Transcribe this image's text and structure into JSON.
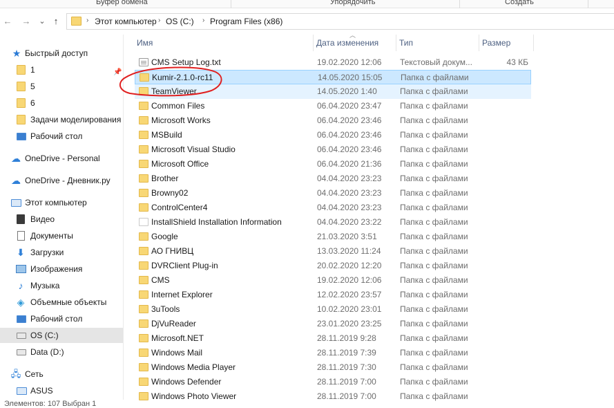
{
  "ribbon": {
    "groups": [
      "Буфер обмена",
      "Упорядочить",
      "Создать"
    ]
  },
  "nav_buttons": {
    "back": "←",
    "forward": "→",
    "dropdown": "⌄",
    "up": "↑"
  },
  "address": {
    "crumbs": [
      "Этот компьютер",
      "OS (C:)",
      "Program Files (x86)"
    ],
    "separator": "›"
  },
  "sidebar": {
    "items": [
      {
        "label": "Быстрый доступ",
        "icon": "star-icon"
      },
      {
        "label": "1",
        "icon": "folder-icon",
        "pinned": true
      },
      {
        "label": "5",
        "icon": "folder-icon"
      },
      {
        "label": "6",
        "icon": "folder-icon"
      },
      {
        "label": "Задачи моделирования",
        "icon": "folder-icon"
      },
      {
        "label": "Рабочий стол",
        "icon": "desktop-icon"
      },
      {
        "label": "OneDrive - Personal",
        "icon": "cloud-icon"
      },
      {
        "label": "OneDrive - Дневник.ру",
        "icon": "cloud-icon"
      },
      {
        "label": "Этот компьютер",
        "icon": "computer-icon"
      },
      {
        "label": "Видео",
        "icon": "video-icon"
      },
      {
        "label": "Документы",
        "icon": "documents-icon"
      },
      {
        "label": "Загрузки",
        "icon": "downloads-icon"
      },
      {
        "label": "Изображения",
        "icon": "pictures-icon"
      },
      {
        "label": "Музыка",
        "icon": "music-icon"
      },
      {
        "label": "Объемные объекты",
        "icon": "3d-objects-icon"
      },
      {
        "label": "Рабочий стол",
        "icon": "desktop-icon"
      },
      {
        "label": "OS (C:)",
        "icon": "drive-icon",
        "selected": true
      },
      {
        "label": "Data (D:)",
        "icon": "drive-icon"
      },
      {
        "label": "Сеть",
        "icon": "network-icon"
      },
      {
        "label": "ASUS",
        "icon": "computer-icon"
      }
    ]
  },
  "columns": {
    "name": "Имя",
    "date": "Дата изменения",
    "type": "Тип",
    "size": "Размер"
  },
  "files": [
    {
      "name": "CMS Setup Log.txt",
      "date": "19.02.2020 12:06",
      "type": "Текстовый докум...",
      "size": "43 КБ",
      "icon": "text-file-icon"
    },
    {
      "name": "Kumir-2.1.0-rc11",
      "date": "14.05.2020 15:05",
      "type": "Папка с файлами",
      "size": "",
      "icon": "folder-icon",
      "state": "selected"
    },
    {
      "name": "TeamViewer",
      "date": "14.05.2020 1:40",
      "type": "Папка с файлами",
      "size": "",
      "icon": "folder-icon",
      "state": "hover"
    },
    {
      "name": "Common Files",
      "date": "06.04.2020 23:47",
      "type": "Папка с файлами",
      "size": "",
      "icon": "folder-icon"
    },
    {
      "name": "Microsoft Works",
      "date": "06.04.2020 23:46",
      "type": "Папка с файлами",
      "size": "",
      "icon": "folder-icon"
    },
    {
      "name": "MSBuild",
      "date": "06.04.2020 23:46",
      "type": "Папка с файлами",
      "size": "",
      "icon": "folder-icon"
    },
    {
      "name": "Microsoft Visual Studio",
      "date": "06.04.2020 23:46",
      "type": "Папка с файлами",
      "size": "",
      "icon": "folder-icon"
    },
    {
      "name": "Microsoft Office",
      "date": "06.04.2020 21:36",
      "type": "Папка с файлами",
      "size": "",
      "icon": "folder-icon"
    },
    {
      "name": "Brother",
      "date": "04.04.2020 23:23",
      "type": "Папка с файлами",
      "size": "",
      "icon": "folder-icon"
    },
    {
      "name": "Browny02",
      "date": "04.04.2020 23:23",
      "type": "Папка с файлами",
      "size": "",
      "icon": "folder-icon"
    },
    {
      "name": "ControlCenter4",
      "date": "04.04.2020 23:23",
      "type": "Папка с файлами",
      "size": "",
      "icon": "folder-icon"
    },
    {
      "name": "InstallShield Installation Information",
      "date": "04.04.2020 23:22",
      "type": "Папка с файлами",
      "size": "",
      "icon": "plain-folder-icon"
    },
    {
      "name": "Google",
      "date": "21.03.2020 3:51",
      "type": "Папка с файлами",
      "size": "",
      "icon": "folder-icon"
    },
    {
      "name": "АО ГНИВЦ",
      "date": "13.03.2020 11:24",
      "type": "Папка с файлами",
      "size": "",
      "icon": "folder-icon"
    },
    {
      "name": "DVRClient Plug-in",
      "date": "20.02.2020 12:20",
      "type": "Папка с файлами",
      "size": "",
      "icon": "folder-icon"
    },
    {
      "name": "CMS",
      "date": "19.02.2020 12:06",
      "type": "Папка с файлами",
      "size": "",
      "icon": "folder-icon"
    },
    {
      "name": "Internet Explorer",
      "date": "12.02.2020 23:57",
      "type": "Папка с файлами",
      "size": "",
      "icon": "folder-icon"
    },
    {
      "name": "3uTools",
      "date": "10.02.2020 23:01",
      "type": "Папка с файлами",
      "size": "",
      "icon": "folder-icon"
    },
    {
      "name": "DjVuReader",
      "date": "23.01.2020 23:25",
      "type": "Папка с файлами",
      "size": "",
      "icon": "folder-icon"
    },
    {
      "name": "Microsoft.NET",
      "date": "28.11.2019 9:28",
      "type": "Папка с файлами",
      "size": "",
      "icon": "folder-icon"
    },
    {
      "name": "Windows Mail",
      "date": "28.11.2019 7:39",
      "type": "Папка с файлами",
      "size": "",
      "icon": "folder-icon"
    },
    {
      "name": "Windows Media Player",
      "date": "28.11.2019 7:30",
      "type": "Папка с файлами",
      "size": "",
      "icon": "folder-icon"
    },
    {
      "name": "Windows Defender",
      "date": "28.11.2019 7:00",
      "type": "Папка с файлами",
      "size": "",
      "icon": "folder-icon"
    },
    {
      "name": "Windows Photo Viewer",
      "date": "28.11.2019 7:00",
      "type": "Папка с файлами",
      "size": "",
      "icon": "folder-icon"
    }
  ],
  "status": {
    "text": "Элементов: 107   Выбран 1"
  },
  "colors": {
    "selection": "#cce8ff",
    "selection_border": "#99d1ff",
    "hover": "#e5f3ff",
    "folder": "#f8d775",
    "annotation": "#e02020"
  }
}
